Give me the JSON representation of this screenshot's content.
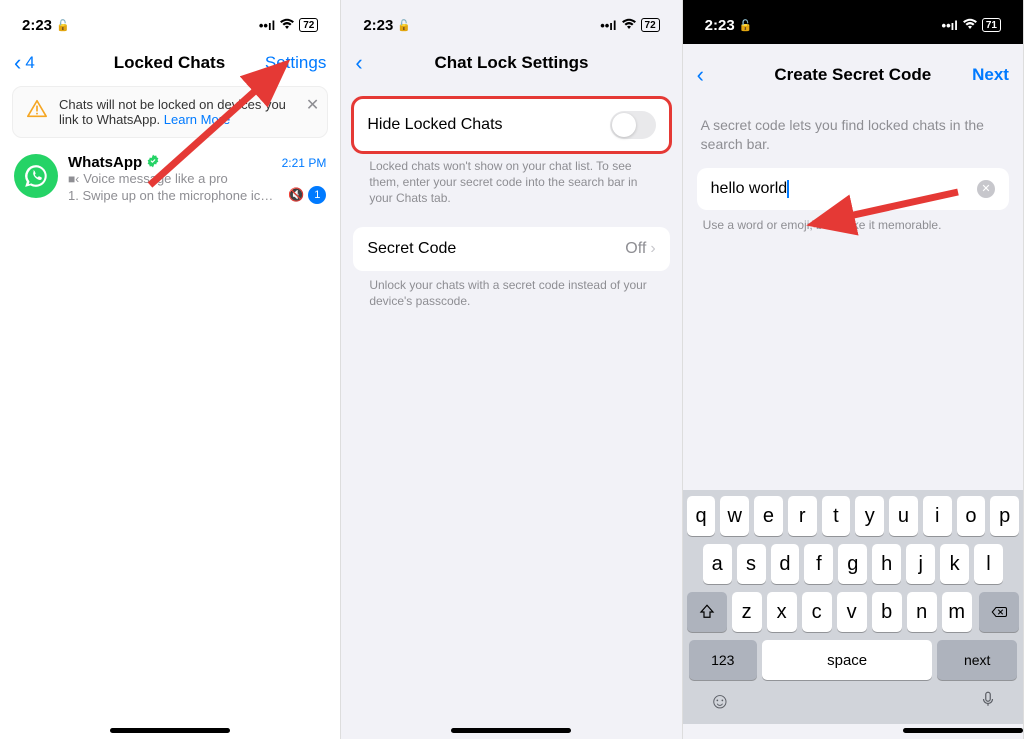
{
  "status": {
    "time": "2:23",
    "lock": "🔒",
    "battery1": "72",
    "battery2": "72",
    "battery3": "71"
  },
  "screen1": {
    "back_count": "4",
    "title": "Locked Chats",
    "settings": "Settings",
    "notice": "Chats will not be locked on devices you link to WhatsApp. ",
    "learn_more": "Learn More",
    "chat_name": "WhatsApp",
    "chat_time": "2:21 PM",
    "chat_sub1": "Voice message like a pro",
    "chat_sub2": "1. Swipe up on the microphone ic…",
    "badge": "1"
  },
  "screen2": {
    "title": "Chat Lock Settings",
    "hide_label": "Hide Locked Chats",
    "hide_note": "Locked chats won't show on your chat list. To see them, enter your secret code into the search bar in your Chats tab.",
    "secret_label": "Secret Code",
    "secret_val": "Off",
    "secret_note": "Unlock your chats with a secret code instead of your device's passcode."
  },
  "screen3": {
    "title": "Create Secret Code",
    "next": "Next",
    "helper": "A secret code lets you find locked chats in the search bar.",
    "input_value": "hello world",
    "field_note": "Use a word or emoji, but make it memorable."
  },
  "keyboard": {
    "row1": [
      "q",
      "w",
      "e",
      "r",
      "t",
      "y",
      "u",
      "i",
      "o",
      "p"
    ],
    "row2": [
      "a",
      "s",
      "d",
      "f",
      "g",
      "h",
      "j",
      "k",
      "l"
    ],
    "row3": [
      "z",
      "x",
      "c",
      "v",
      "b",
      "n",
      "m"
    ],
    "k123": "123",
    "space": "space",
    "next": "next"
  }
}
